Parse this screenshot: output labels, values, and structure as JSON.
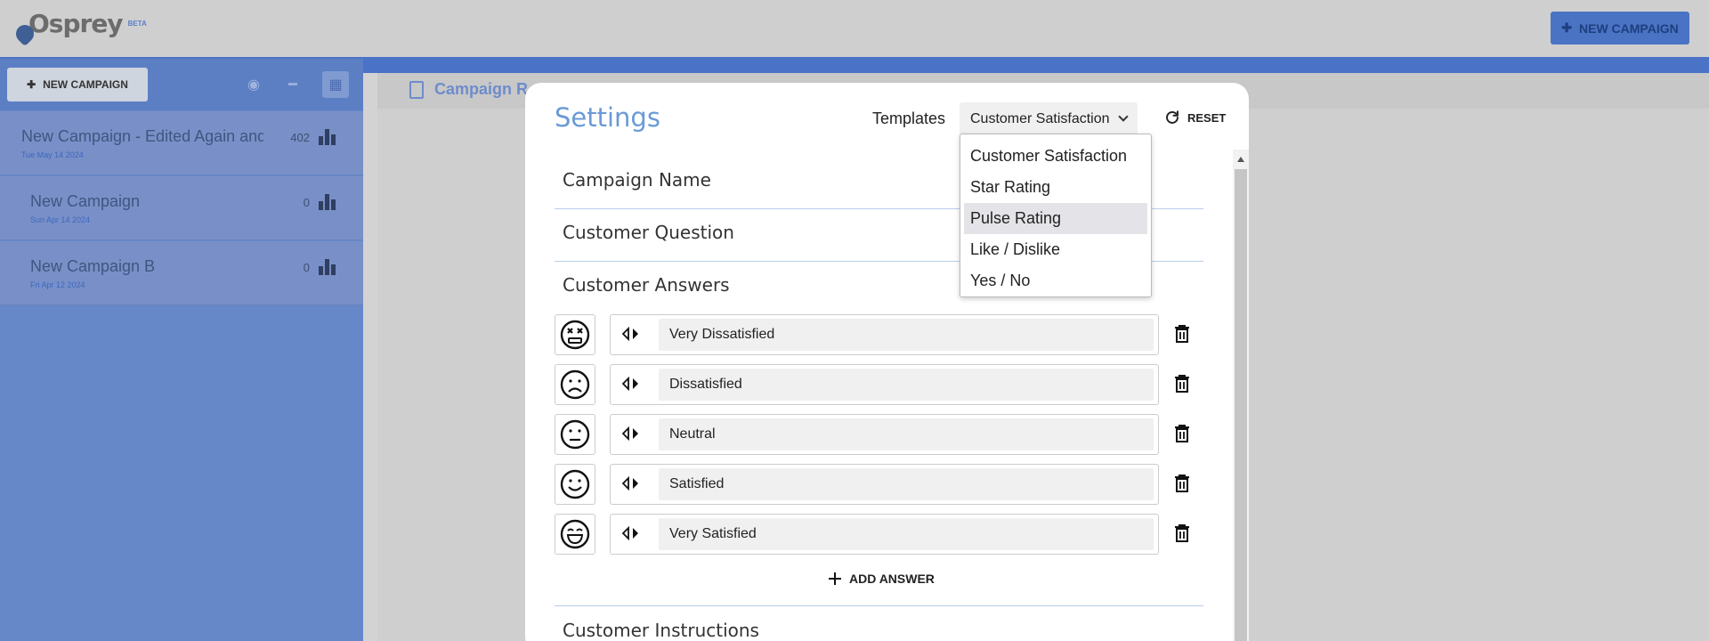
{
  "app": {
    "logo_text": "Osprey",
    "logo_beta": "BETA",
    "top_new_campaign": "NEW CAMPAIGN"
  },
  "sidebar": {
    "new_campaign_label": "NEW CAMPAIGN",
    "campaigns": [
      {
        "title": "New Campaign - Edited Again and a",
        "date": "Tue May 14 2024",
        "count": "402"
      },
      {
        "title": "New Campaign",
        "date": "Sun Apr 14 2024",
        "count": "0"
      },
      {
        "title": "New Campaign B",
        "date": "Fri Apr 12 2024",
        "count": "0"
      }
    ]
  },
  "main": {
    "tab_label": "Campaign R"
  },
  "modal": {
    "title": "Settings",
    "templates_label": "Templates",
    "template_selected": "Customer Satisfaction",
    "reset_label": "RESET",
    "sections": {
      "campaign_name": "Campaign Name",
      "customer_question": "Customer Question",
      "customer_answers": "Customer Answers",
      "customer_instructions": "Customer Instructions"
    },
    "answers": [
      {
        "icon": "very-dissatisfied-face-icon",
        "value": "Very Dissatisfied"
      },
      {
        "icon": "dissatisfied-face-icon",
        "value": "Dissatisfied"
      },
      {
        "icon": "neutral-face-icon",
        "value": "Neutral"
      },
      {
        "icon": "satisfied-face-icon",
        "value": "Satisfied"
      },
      {
        "icon": "very-satisfied-face-icon",
        "value": "Very Satisfied"
      }
    ],
    "add_answer_label": "ADD ANSWER"
  },
  "dropdown": {
    "options": [
      "Customer Satisfaction",
      "Star Rating",
      "Pulse Rating",
      "Like / Dislike",
      "Yes / No"
    ],
    "highlighted": "Pulse Rating"
  },
  "colors": {
    "accent": "#6a9ad6",
    "sidebar_blue": "#6687c8",
    "brand_blue": "#4a73c4"
  }
}
